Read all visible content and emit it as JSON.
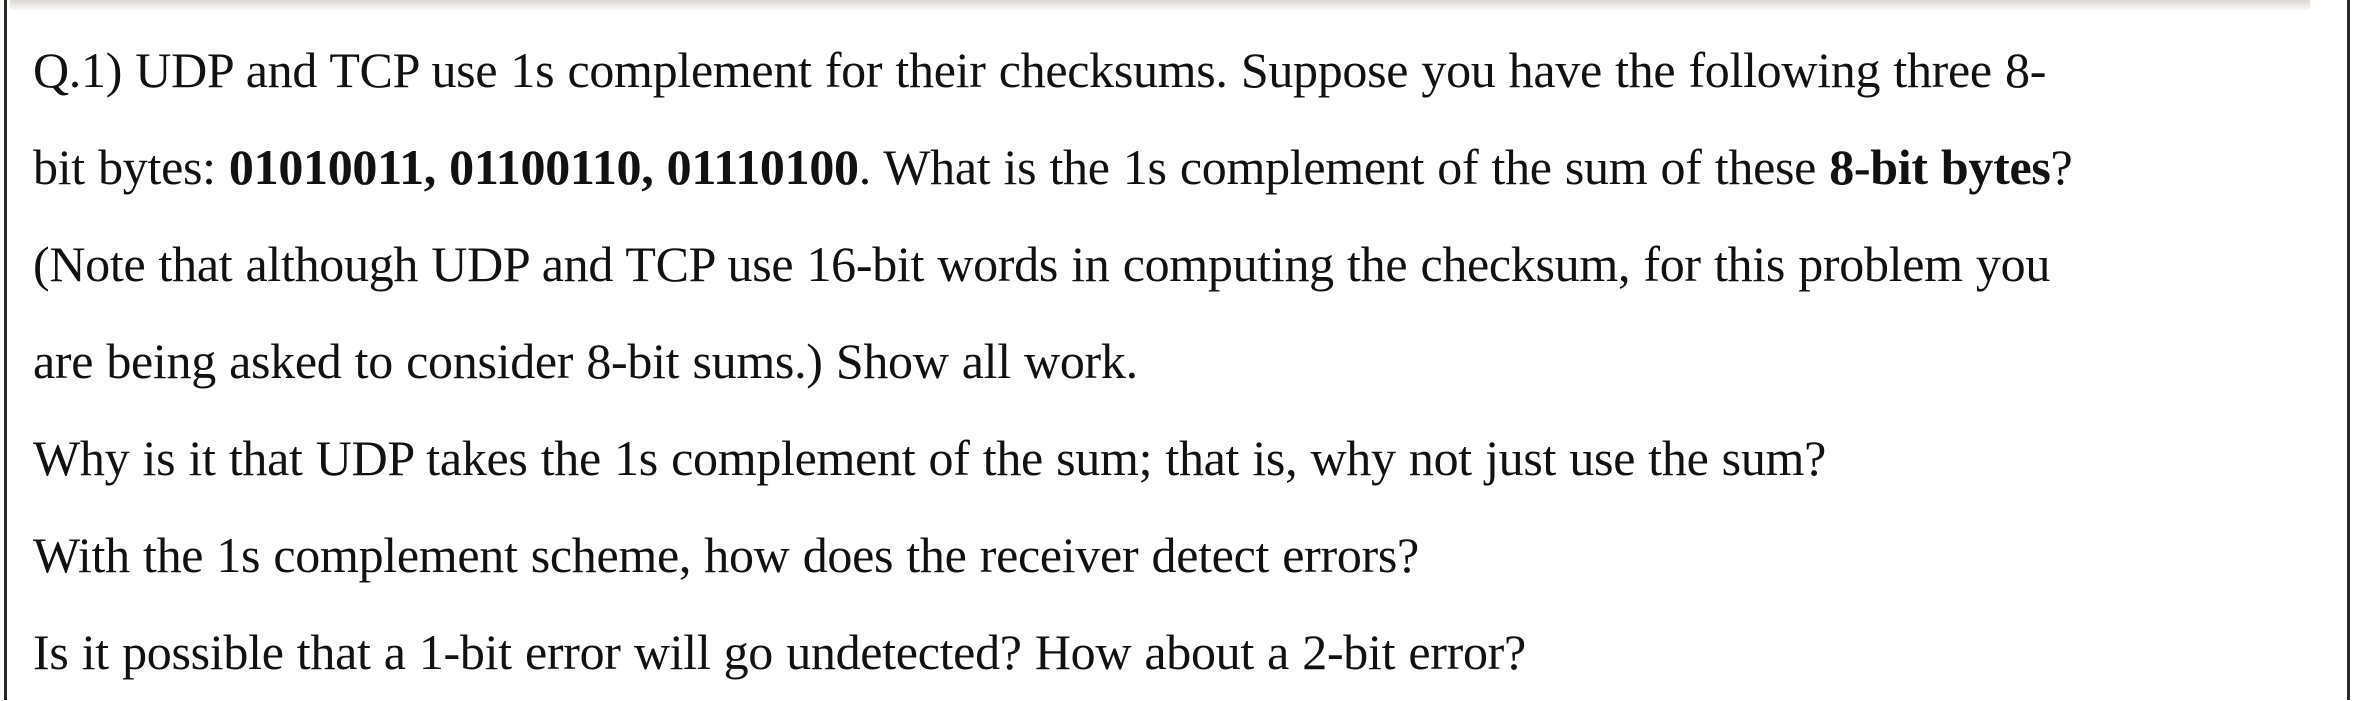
{
  "question": {
    "number": "Q.1)",
    "lines": [
      {
        "segments": [
          {
            "text": "Q.1) UDP and TCP use 1s complement for their checksums. Suppose you have the following three 8-",
            "bold": false
          }
        ]
      },
      {
        "segments": [
          {
            "text": "bit bytes: ",
            "bold": false
          },
          {
            "text": "01010011, 01100110, 01110100",
            "bold": true
          },
          {
            "text": ". What is the 1s complement of the sum of these ",
            "bold": false
          },
          {
            "text": "8-bit bytes",
            "bold": true
          },
          {
            "text": "?",
            "bold": false
          }
        ]
      },
      {
        "segments": [
          {
            "text": "(Note that although UDP and TCP use 16-bit words in computing the checksum, for this problem you",
            "bold": false
          }
        ]
      },
      {
        "segments": [
          {
            "text": "are being asked to consider 8-bit sums.) Show all work.",
            "bold": false
          }
        ]
      },
      {
        "segments": [
          {
            "text": "Why is it that UDP takes the 1s complement of the sum; that is, why not just use the sum?",
            "bold": false
          }
        ]
      },
      {
        "segments": [
          {
            "text": "With the 1s complement scheme, how does the receiver detect errors?",
            "bold": false
          }
        ]
      },
      {
        "segments": [
          {
            "text": "Is it possible that a 1-bit error will go undetected? How about a 2-bit error?",
            "bold": false
          }
        ]
      }
    ],
    "bytes": [
      "01010011",
      "01100110",
      "01110100"
    ]
  }
}
